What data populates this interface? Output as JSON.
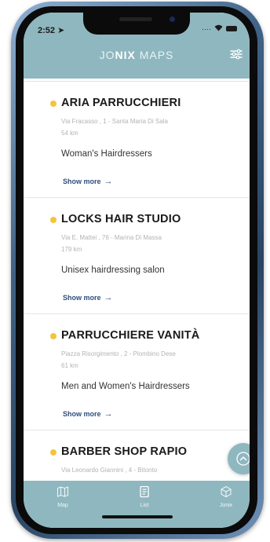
{
  "status_bar": {
    "time": "2:52"
  },
  "header": {
    "title_prefix": "JO",
    "title_bold": "NIX",
    "title_suffix": " MAPS"
  },
  "listings": [
    {
      "name": "ARIA PARRUCCHIERI",
      "address": "Via Fracasso , 1 - Santa Maria Di Sala",
      "distance": "54 km",
      "category": "Woman's Hairdressers",
      "more": "Show more"
    },
    {
      "name": "LOCKS HAIR STUDIO",
      "address": "Via E. Mattei , 76 - Marina Di Massa",
      "distance": "179 km",
      "category": "Unisex hairdressing salon",
      "more": "Show more"
    },
    {
      "name": "PARRUCCHIERE VANITÀ",
      "address": "Piazza Risorgimento , 2 - Piombino Dese",
      "distance": "61 km",
      "category": "Men and Women's Hairdressers",
      "more": "Show more"
    },
    {
      "name": "BARBER SHOP RAPIO",
      "address": "Via Leonardo Giannini , 4 - Bitonto",
      "distance": "",
      "category": "",
      "more": ""
    }
  ],
  "tabs": [
    {
      "label": "Map",
      "icon": "map-icon"
    },
    {
      "label": "List",
      "icon": "list-icon"
    },
    {
      "label": "Jonix",
      "icon": "cube-icon"
    }
  ],
  "colors": {
    "accent": "#8fb7bf",
    "dot": "#f2c53d",
    "link": "#2f4e7a"
  }
}
